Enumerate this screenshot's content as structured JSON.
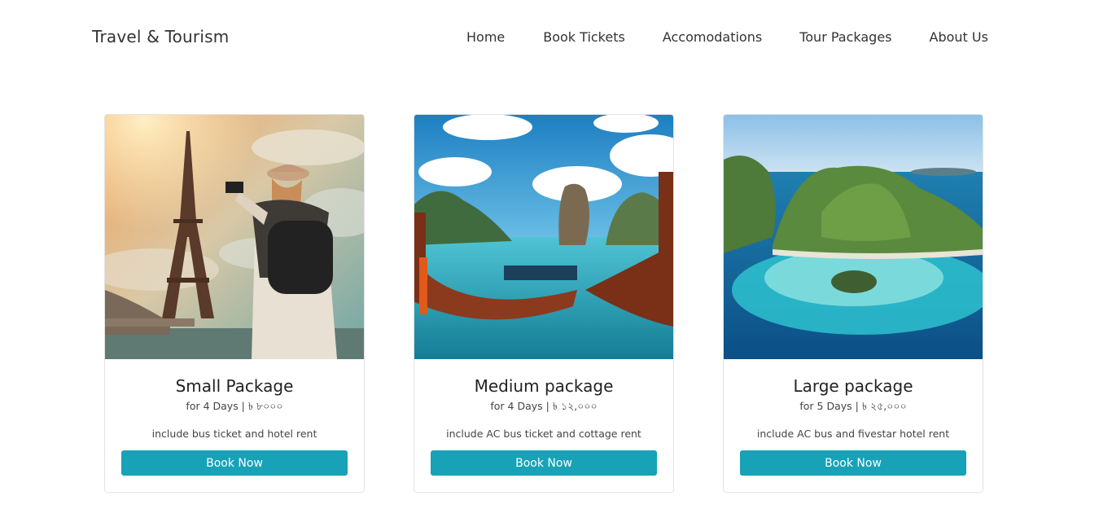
{
  "header": {
    "brand": "Travel & Tourism",
    "nav": [
      {
        "label": "Home"
      },
      {
        "label": "Book Tickets"
      },
      {
        "label": "Accomodations"
      },
      {
        "label": "Tour Packages"
      },
      {
        "label": "About Us"
      }
    ]
  },
  "packages": [
    {
      "title": "Small Package",
      "subtitle": "for 4 Days | ৳ ৮০০০",
      "description": "include bus ticket and hotel rent",
      "button": "Book Now"
    },
    {
      "title": "Medium package",
      "subtitle": "for 4 Days | ৳ ১২,০০০",
      "description": "include AC bus ticket and cottage rent",
      "button": "Book Now"
    },
    {
      "title": "Large package",
      "subtitle": "for 5 Days | ৳ ২৫,০০০",
      "description": "include AC bus and fivestar hotel rent",
      "button": "Book Now"
    }
  ],
  "colors": {
    "button": "#17a2b8",
    "text": "#333333"
  }
}
